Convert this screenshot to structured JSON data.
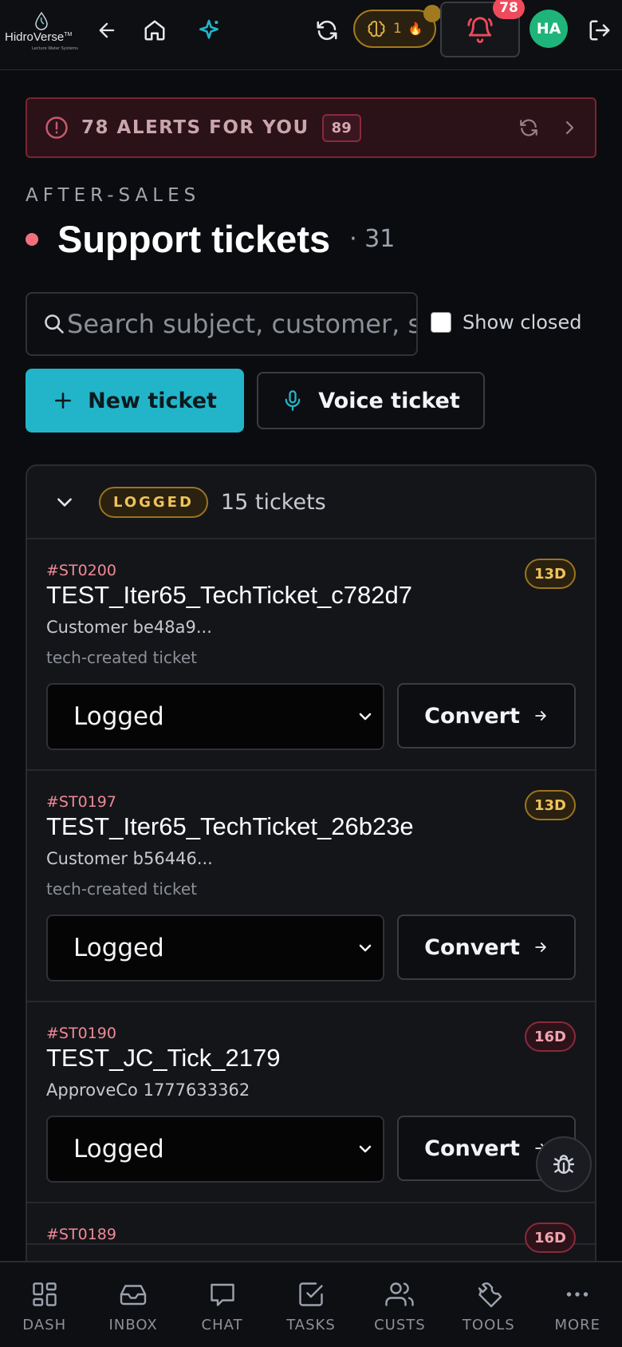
{
  "app": {
    "logo_text": "HidroVerse",
    "logo_tm": "TM",
    "logo_sub": "Lecture Water Systems"
  },
  "topbar": {
    "brain_count": "1",
    "brain_emoji": "🔥",
    "notifications_count": "78",
    "avatar_initials": "HA"
  },
  "alerts": {
    "text": "78 ALERTS FOR YOU",
    "count": "89"
  },
  "page": {
    "eyebrow": "AFTER-SALES",
    "title": "Support tickets",
    "count": "· 31"
  },
  "search": {
    "placeholder": "Search subject, customer, status"
  },
  "filters": {
    "show_closed_label": "Show closed",
    "show_closed_checked": false
  },
  "actions": {
    "new_ticket": "New ticket",
    "voice_ticket": "Voice ticket"
  },
  "group": {
    "status": "LOGGED",
    "count_label": "15 tickets",
    "tickets": [
      {
        "id": "#ST0200",
        "subject": "TEST_Iter65_TechTicket_c782d7",
        "customer": "Customer be48a9...",
        "note": "tech-created ticket",
        "age": "13D",
        "age_level": "warn",
        "status_value": "Logged",
        "convert_label": "Convert"
      },
      {
        "id": "#ST0197",
        "subject": "TEST_Iter65_TechTicket_26b23e",
        "customer": "Customer b56446...",
        "note": "tech-created ticket",
        "age": "13D",
        "age_level": "warn",
        "status_value": "Logged",
        "convert_label": "Convert"
      },
      {
        "id": "#ST0190",
        "subject": "TEST_JC_Tick_2179",
        "customer": "ApproveCo 1777633362",
        "note": "",
        "age": "16D",
        "age_level": "danger",
        "status_value": "Logged",
        "convert_label": "Convert"
      },
      {
        "id": "#ST0189",
        "subject": "",
        "customer": "",
        "note": "",
        "age": "16D",
        "age_level": "danger",
        "status_value": "",
        "convert_label": ""
      }
    ]
  },
  "bottom_nav": [
    {
      "label": "DASH",
      "icon": "dashboard-grid-icon"
    },
    {
      "label": "INBOX",
      "icon": "inbox-tray-icon"
    },
    {
      "label": "CHAT",
      "icon": "chat-bubble-icon"
    },
    {
      "label": "TASKS",
      "icon": "checkbox-icon"
    },
    {
      "label": "CUSTS",
      "icon": "users-icon"
    },
    {
      "label": "TOOLS",
      "icon": "wrench-icon"
    },
    {
      "label": "MORE",
      "icon": "more-dots-icon"
    }
  ],
  "colors": {
    "accent": "#22b5c9",
    "alert": "#ef4a5c",
    "logged": "#f0c35a",
    "avatar": "#1fb47a"
  }
}
